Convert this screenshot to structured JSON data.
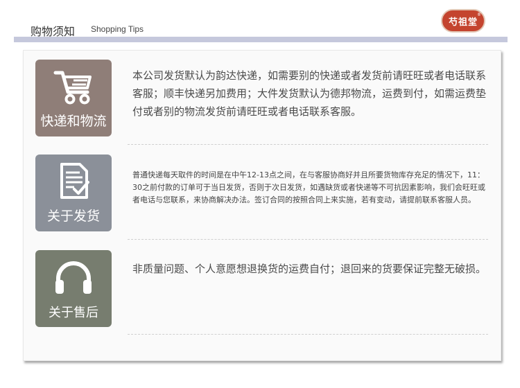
{
  "header": {
    "title": "购物须知",
    "subtitle": "Shopping Tips",
    "logo_text": "芍祖堂",
    "logo_mark": "®"
  },
  "sections": [
    {
      "icon": "shopping-cart-icon",
      "label": "快递和物流",
      "text": "本公司发货默认为韵达快递，如需要别的快递或者发货前请旺旺或者电话联系客服；顺丰快递另加费用；大件发货默认为德邦物流，运费到付，如需运费垫付或者别的物流发货前请旺旺或者电话联系客服。"
    },
    {
      "icon": "document-check-icon",
      "label": "关于发货",
      "text": "普通快递每天取件的时间是在中午12-13点之间，在与客服协商好并且所要货物库存充足的情况下，11：30之前付款的订单可于当日发货，否则于次日发货，如遇缺货或者快递等不可抗因素影响，我们会旺旺或者电话与您联系，来协商解决办法。签订合同的按照合同上来实施，若有变动，请提前联系客服人员。"
    },
    {
      "icon": "headphones-icon",
      "label": "关于售后",
      "text": "非质量问题、个人意愿想退换货的运费自付；退回来的货要保证完整无破损。"
    }
  ],
  "colors": {
    "tile_1": "#8f7e78",
    "tile_2": "#8b9099",
    "tile_3": "#777d6f",
    "logo": "#c4442f",
    "header_bar": "#c5c8dc"
  }
}
